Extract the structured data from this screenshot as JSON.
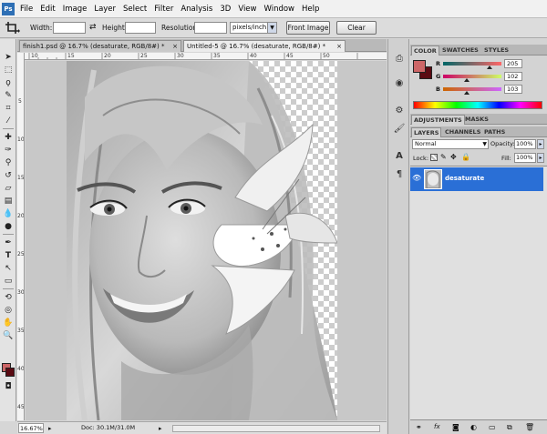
{
  "menu": {
    "logo": "Ps",
    "items": [
      "File",
      "Edit",
      "Image",
      "Layer",
      "Select",
      "Filter",
      "Analysis",
      "3D",
      "View",
      "Window",
      "Help"
    ]
  },
  "options": {
    "width_label": "Width:",
    "height_label": "Height:",
    "resolution_label": "Resolution:",
    "units_value": "pixels/inch",
    "front_image_label": "Front Image",
    "clear_label": "Clear"
  },
  "tabs": [
    {
      "label": "finish1.psd @ 16.7% (desaturate, RGB/8#) *",
      "active": false
    },
    {
      "label": "Untitled-5 @ 16.7% (desaturate, RGB/8#) *",
      "active": true
    }
  ],
  "ruler_top": [
    "10",
    "15",
    "20",
    "25",
    "30",
    "35",
    "40",
    "45",
    "50"
  ],
  "ruler_left": [
    "5",
    "10",
    "15",
    "20",
    "25",
    "30",
    "35",
    "40",
    "45"
  ],
  "status": {
    "zoom": "16.67%",
    "doc": "Doc: 30.1M/31.0M"
  },
  "color_panel": {
    "tabs": [
      "COLOR",
      "SWATCHES",
      "STYLES"
    ],
    "r_label": "R",
    "r_value": "205",
    "g_label": "G",
    "g_value": "102",
    "b_label": "B",
    "b_value": "103",
    "fg_color": "#cd6667",
    "bg_color": "#5a0a12"
  },
  "adjust_panel": {
    "tabs": [
      "ADJUSTMENTS",
      "MASKS"
    ]
  },
  "layers_panel": {
    "tabs": [
      "LAYERS",
      "CHANNELS",
      "PATHS"
    ],
    "blend_mode": "Normal",
    "opacity_label": "Opacity:",
    "opacity_value": "100%",
    "lock_label": "Lock:",
    "fill_label": "Fill:",
    "fill_value": "100%",
    "layer_name": "desaturate"
  },
  "accent": "#2a6fd6"
}
